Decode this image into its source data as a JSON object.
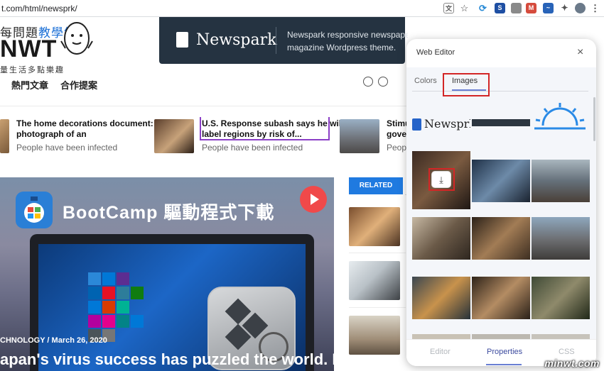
{
  "browser": {
    "url": "t.com/html/newsprk/"
  },
  "site": {
    "logo_line1": "每問題",
    "logo_line1_hi": "教學網",
    "logo_big": "NWT",
    "logo_sub": "量生活多點樂趣",
    "banner_brand": "Newspark",
    "banner_text_1": "Newspark responsive newspaper",
    "banner_text_2": "magazine Wordpress theme.",
    "nav": [
      "熱門文章",
      "合作提案"
    ]
  },
  "ticker": [
    {
      "title_1": "The home decorations document:",
      "title_2": "photograph of an",
      "sub": "People have been infected"
    },
    {
      "title_1": "U.S. Response subash says he will",
      "title_2": "label regions by risk of...",
      "sub": "People have been infected"
    },
    {
      "title_1": "Stimu",
      "title_2": "gover",
      "sub": "People"
    }
  ],
  "hero": {
    "title": "BootCamp 驅動程式下載",
    "category": "CHNOLOGY",
    "date": "March 26, 2020",
    "headline": "apan's virus success has puzzled the world. Is"
  },
  "related": {
    "badge": "RELATED"
  },
  "panel": {
    "title": "Web Editor",
    "close": "×",
    "tabs": [
      "Colors",
      "Images"
    ],
    "brand_small": "Newsprk",
    "bottom_tabs": [
      "Editor",
      "Properties",
      "CSS"
    ],
    "bottom_active_color": "#3b4a9e"
  },
  "watermark": "minwt.com",
  "colors": {
    "accent": "#1f7ae0",
    "highlight_box": "#d32626",
    "panel_tab": "#6a7fd3"
  }
}
